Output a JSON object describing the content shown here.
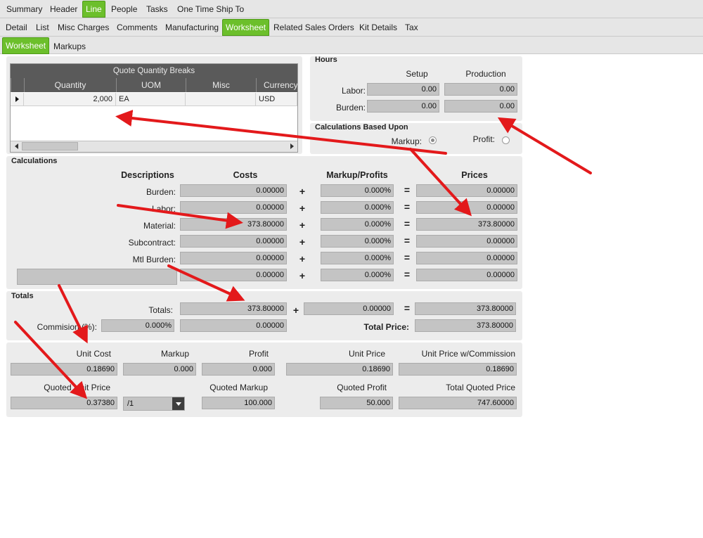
{
  "tabs1": [
    "Summary",
    "Header",
    "Line",
    "People",
    "Tasks",
    "One Time Ship To"
  ],
  "tabs2": [
    "Detail",
    "List",
    "Misc Charges",
    "Comments",
    "Manufacturing",
    "Worksheet",
    "Related Sales Orders",
    "Kit Details",
    "Tax"
  ],
  "tabs3": [
    "Worksheet",
    "Markups"
  ],
  "grid": {
    "title": "Quote Quantity Breaks",
    "columns": [
      "Quantity",
      "UOM",
      "Misc",
      "Currency Co"
    ],
    "row": {
      "quantity": "2,000",
      "uom": "EA",
      "misc": "",
      "currency": "USD"
    }
  },
  "hours": {
    "title": "Hours",
    "setup_label": "Setup",
    "production_label": "Production",
    "labor_label": "Labor:",
    "burden_label": "Burden:",
    "labor_setup": "0.00",
    "labor_production": "0.00",
    "burden_setup": "0.00",
    "burden_production": "0.00"
  },
  "basis": {
    "title": "Calculations Based Upon",
    "markup_label": "Markup:",
    "profit_label": "Profit:",
    "selected": "markup"
  },
  "calc": {
    "title": "Calculations",
    "headers": {
      "descriptions": "Descriptions",
      "costs": "Costs",
      "markup": "Markup/Profits",
      "prices": "Prices"
    },
    "plus": "+",
    "equals": "=",
    "rows": [
      {
        "label": "Burden:",
        "cost": "0.00000",
        "markup": "0.000%",
        "price": "0.00000"
      },
      {
        "label": "Labor:",
        "cost": "0.00000",
        "markup": "0.000%",
        "price": "0.00000"
      },
      {
        "label": "Material:",
        "cost": "373.80000",
        "markup": "0.000%",
        "price": "373.80000"
      },
      {
        "label": "Subcontract:",
        "cost": "0.00000",
        "markup": "0.000%",
        "price": "0.00000"
      },
      {
        "label": "Mtl Burden:",
        "cost": "0.00000",
        "markup": "0.000%",
        "price": "0.00000"
      },
      {
        "label": "",
        "cost": "0.00000",
        "markup": "0.000%",
        "price": "0.00000"
      }
    ]
  },
  "totals": {
    "title": "Totals",
    "totals_label": "Totals:",
    "cost": "373.80000",
    "markup": "0.00000",
    "price": "373.80000",
    "commission_label": "Commision (%):",
    "commission_pct": "0.000%",
    "commission_amt": "0.00000",
    "total_price_label": "Total Price:",
    "total_price": "373.80000"
  },
  "unit": {
    "unit_cost_label": "Unit Cost",
    "unit_cost": "0.18690",
    "markup_label": "Markup",
    "markup": "0.000",
    "profit_label": "Profit",
    "profit": "0.000",
    "unit_price_label": "Unit Price",
    "unit_price": "0.18690",
    "unit_price_comm_label": "Unit Price w/Commission",
    "unit_price_comm": "0.18690",
    "quoted_unit_price_label": "Quoted Unit Price",
    "quoted_unit_price": "0.37380",
    "per_value": "/1",
    "quoted_markup_label": "Quoted Markup",
    "quoted_markup": "100.000",
    "quoted_profit_label": "Quoted Profit",
    "quoted_profit": "50.000",
    "total_quoted_label": "Total Quoted Price",
    "total_quoted": "747.60000"
  },
  "colors": {
    "accent": "#6cbf2b",
    "panel": "#ececec",
    "field": "#c4c4c4",
    "arrow": "#e3191b"
  }
}
